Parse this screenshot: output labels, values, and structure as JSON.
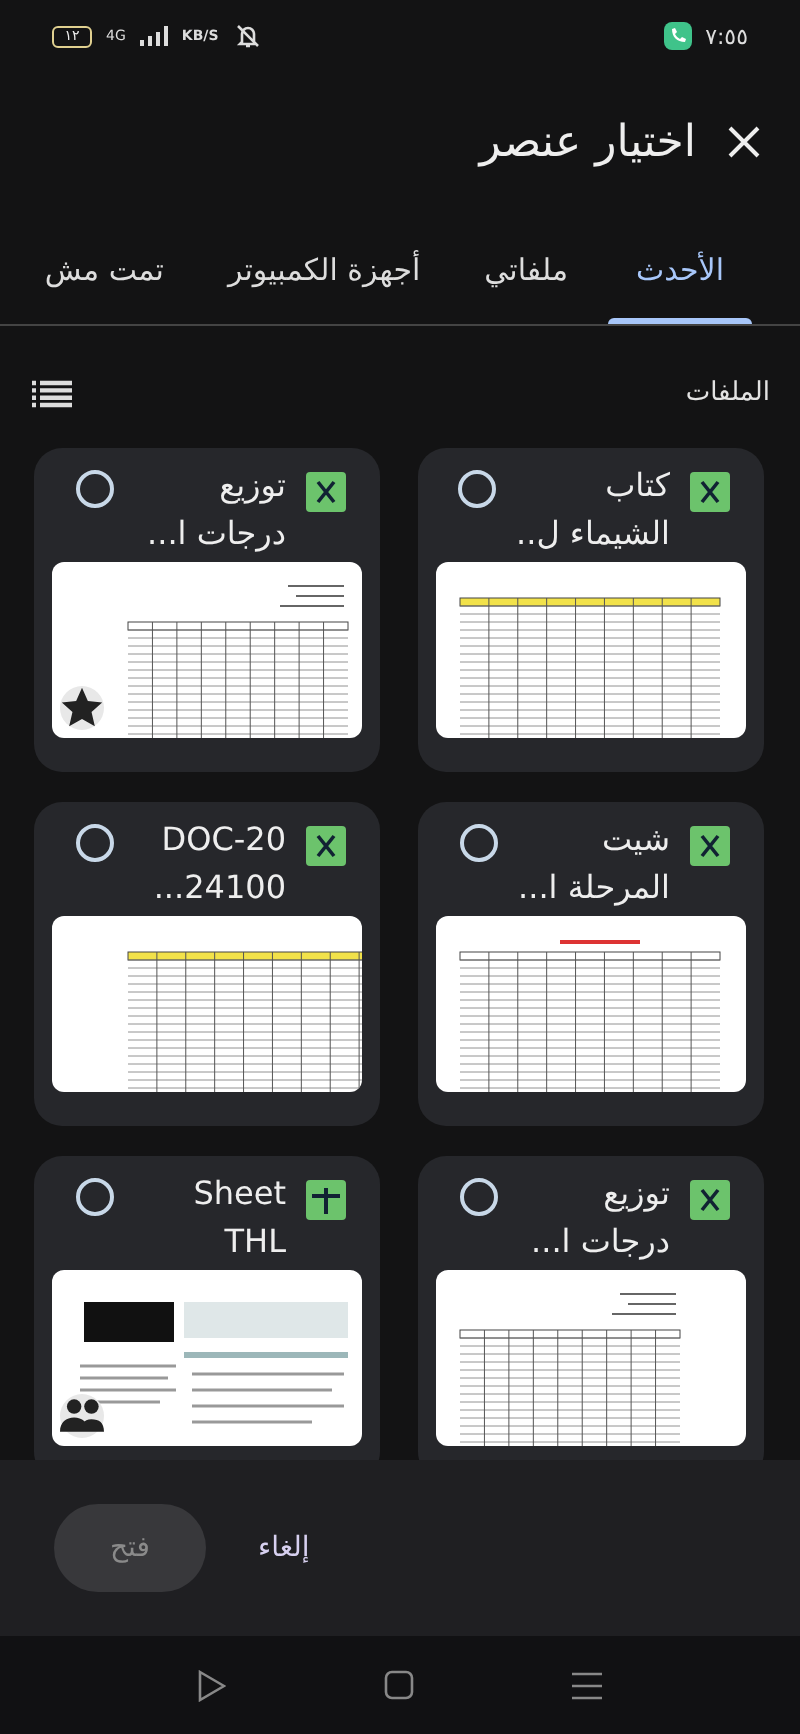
{
  "status_bar": {
    "time": "٧:٥٥",
    "battery": "١٢",
    "network": "4G",
    "speed": "KB/S"
  },
  "header": {
    "title": "اختيار عنصر"
  },
  "tabs": [
    {
      "label": "الأحدث",
      "selected": true
    },
    {
      "label": "ملفاتي",
      "selected": false
    },
    {
      "label": "أجهزة الكمبيوتر",
      "selected": false
    },
    {
      "label": "تمت مش",
      "selected": false
    }
  ],
  "section": {
    "title": "الملفات"
  },
  "files": [
    {
      "kind": "excel",
      "title": "كتاب",
      "subtitle": "الشيماء ل..",
      "selected": false,
      "starred": false,
      "shared": false
    },
    {
      "kind": "excel",
      "title": "توزيع",
      "subtitle": "درجات ا...",
      "selected": false,
      "starred": true,
      "shared": false
    },
    {
      "kind": "excel",
      "title": "شيت",
      "subtitle": "المرحلة ا...",
      "selected": false,
      "starred": false,
      "shared": false
    },
    {
      "kind": "excel",
      "title": "DOC-20",
      "subtitle": "24100...",
      "selected": false,
      "starred": false,
      "shared": false
    },
    {
      "kind": "excel",
      "title": "توزيع",
      "subtitle": "درجات ا...",
      "selected": false,
      "starred": false,
      "shared": false
    },
    {
      "kind": "sheets",
      "title": "Sheet",
      "subtitle": "THL",
      "selected": false,
      "starred": false,
      "shared": true
    }
  ],
  "actions": {
    "cancel": {
      "label": "إلغاء"
    },
    "open": {
      "label": "فتح",
      "disabled": true
    }
  }
}
